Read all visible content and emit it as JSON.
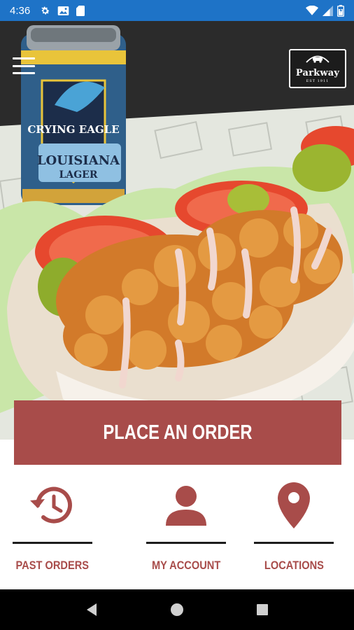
{
  "status_bar": {
    "time": "4:36",
    "left_icons": [
      "gear-icon",
      "photo-icon",
      "sd-card-icon"
    ],
    "right_icons": [
      "wifi-icon",
      "signal-icon",
      "battery-icon"
    ]
  },
  "header": {
    "menu_icon": "hamburger-menu-icon",
    "logo": {
      "name": "Parkway",
      "est": "EST 1911"
    }
  },
  "hero": {
    "image": "shrimp po-boy sandwich with Louisiana Lager beer can"
  },
  "order_button": {
    "label": "PLACE AN ORDER"
  },
  "actions": [
    {
      "label": "PAST ORDERS",
      "icon": "history-icon"
    },
    {
      "label": "MY ACCOUNT",
      "icon": "person-icon"
    },
    {
      "label": "LOCATIONS",
      "icon": "location-pin-icon"
    }
  ],
  "nav_bar": {
    "buttons": [
      "back-icon",
      "home-icon",
      "recents-icon"
    ]
  },
  "colors": {
    "accent": "#a84c4a",
    "status_bar": "#1e73c7",
    "nav_bar": "#000000"
  }
}
